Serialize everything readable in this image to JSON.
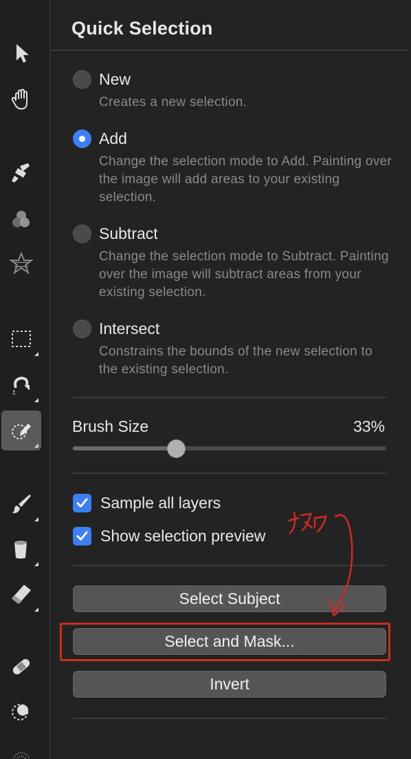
{
  "toolbar": {
    "tools": [
      {
        "icon": "move-arrow-icon"
      },
      {
        "icon": "hand-icon"
      },
      {
        "icon": "paint-bucket-brush-icon"
      },
      {
        "icon": "color-circles-icon"
      },
      {
        "icon": "star-filter-icon"
      },
      {
        "icon": "rectangle-select-icon"
      },
      {
        "icon": "magnetic-lasso-icon"
      },
      {
        "icon": "quick-selection-icon",
        "active": true
      },
      {
        "icon": "paintbrush-icon"
      },
      {
        "icon": "fill-bucket-icon"
      },
      {
        "icon": "eraser-icon"
      },
      {
        "icon": "bandage-heal-icon"
      },
      {
        "icon": "clone-stamp-icon"
      },
      {
        "icon": "dotted-brush-icon"
      }
    ]
  },
  "panel": {
    "title": "Quick Selection",
    "modes": [
      {
        "label": "New",
        "description": "Creates a new selection.",
        "selected": false
      },
      {
        "label": "Add",
        "description": "Change the selection mode to Add. Painting over the image will add areas to your existing selection.",
        "selected": true
      },
      {
        "label": "Subtract",
        "description": "Change the selection mode to Subtract. Painting over the image will subtract areas from your existing selection.",
        "selected": false
      },
      {
        "label": "Intersect",
        "description": "Constrains the bounds of the new selection to the existing selection.",
        "selected": false
      }
    ],
    "brush_size": {
      "label": "Brush Size",
      "value": "33%",
      "fraction": 0.33
    },
    "options": [
      {
        "label": "Sample all layers",
        "checked": true
      },
      {
        "label": "Show selection preview",
        "checked": true
      }
    ],
    "buttons": {
      "select_subject": "Select Subject",
      "select_and_mask": "Select and Mask...",
      "invert": "Invert"
    }
  },
  "annotation": {
    "handwritten_text": "マスク",
    "color": "#d02a24"
  },
  "colors": {
    "accent": "#3d7ff5",
    "background": "#232323",
    "annotation": "#d02a24"
  }
}
